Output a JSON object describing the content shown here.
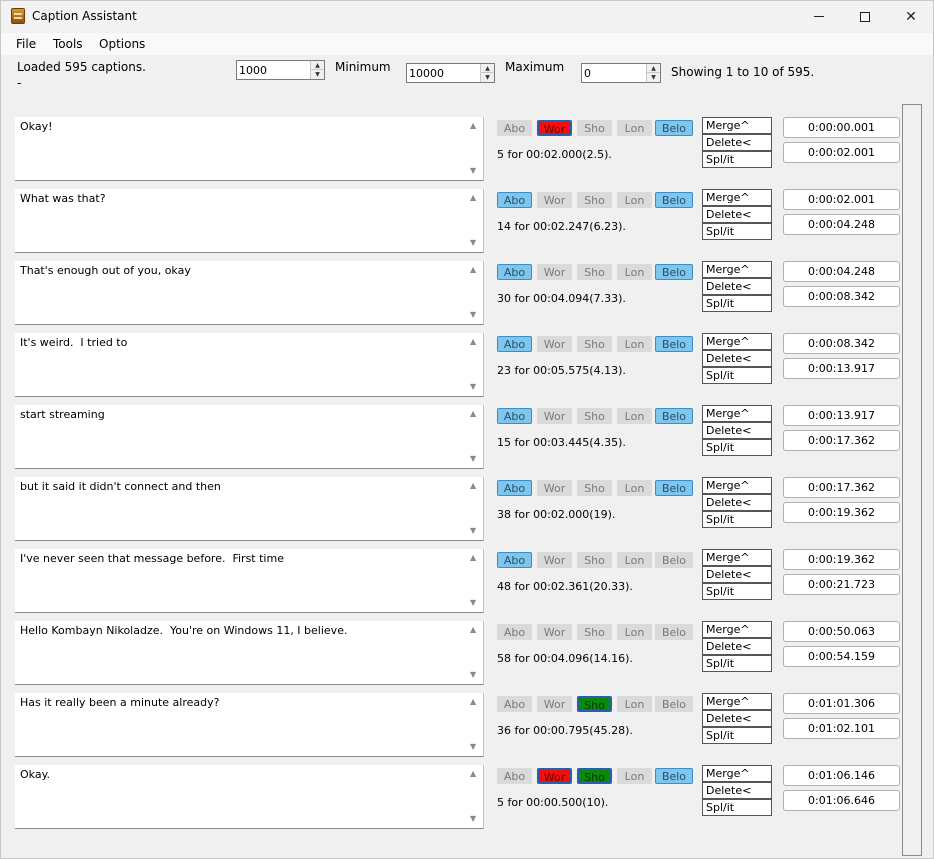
{
  "window": {
    "title": "Caption Assistant"
  },
  "menu": [
    "File",
    "Tools",
    "Options"
  ],
  "status": {
    "loaded": "Loaded 595 captions.",
    "dash": "-",
    "showing": "Showing 1 to 10 of 595."
  },
  "controls": {
    "first_value": "1000",
    "minimum_label": "Minimum",
    "minimum_value": "10000",
    "maximum_label": "Maximum",
    "maximum_value": "0"
  },
  "flag_labels": [
    "Abo",
    "Wor",
    "Sho",
    "Lon",
    "Belo"
  ],
  "action_labels": {
    "merge": "Merge^",
    "delete": "Delete<",
    "split": "Spl/it"
  },
  "colors": {
    "blue": "#7fc6ec",
    "red": "#f01010",
    "green": "#0a8a0a",
    "off": "#dadada"
  },
  "rows": [
    {
      "text": "Okay!",
      "stats": "5 for 00:02.000(2.5).",
      "start": "0:00:00.001",
      "end": "0:00:02.001",
      "flags": [
        "off",
        "red",
        "off",
        "off",
        "blue"
      ]
    },
    {
      "text": "What was that?",
      "stats": "14 for 00:02.247(6.23).",
      "start": "0:00:02.001",
      "end": "0:00:04.248",
      "flags": [
        "blue",
        "off",
        "off",
        "off",
        "blue"
      ]
    },
    {
      "text": "That's enough out of you, okay",
      "stats": "30 for 00:04.094(7.33).",
      "start": "0:00:04.248",
      "end": "0:00:08.342",
      "flags": [
        "blue",
        "off",
        "off",
        "off",
        "blue"
      ]
    },
    {
      "text": "It's weird.  I tried to",
      "stats": "23 for 00:05.575(4.13).",
      "start": "0:00:08.342",
      "end": "0:00:13.917",
      "flags": [
        "blue",
        "off",
        "off",
        "off",
        "blue"
      ]
    },
    {
      "text": "start streaming",
      "stats": "15 for 00:03.445(4.35).",
      "start": "0:00:13.917",
      "end": "0:00:17.362",
      "flags": [
        "blue",
        "off",
        "off",
        "off",
        "blue"
      ]
    },
    {
      "text": "but it said it didn't connect and then",
      "stats": "38 for 00:02.000(19).",
      "start": "0:00:17.362",
      "end": "0:00:19.362",
      "flags": [
        "blue",
        "off",
        "off",
        "off",
        "blue"
      ]
    },
    {
      "text": "I've never seen that message before.  First time",
      "stats": "48 for 00:02.361(20.33).",
      "start": "0:00:19.362",
      "end": "0:00:21.723",
      "flags": [
        "blue",
        "off",
        "off",
        "off",
        "off"
      ]
    },
    {
      "text": "Hello Kombayn Nikoladze.  You're on Windows 11, I believe.",
      "stats": "58 for 00:04.096(14.16).",
      "start": "0:00:50.063",
      "end": "0:00:54.159",
      "flags": [
        "off",
        "off",
        "off",
        "off",
        "off"
      ]
    },
    {
      "text": "Has it really been a minute already?",
      "stats": "36 for 00:00.795(45.28).",
      "start": "0:01:01.306",
      "end": "0:01:02.101",
      "flags": [
        "off",
        "off",
        "green",
        "off",
        "off"
      ]
    },
    {
      "text": "Okay.",
      "stats": "5 for 00:00.500(10).",
      "start": "0:01:06.146",
      "end": "0:01:06.646",
      "flags": [
        "off",
        "red",
        "green",
        "off",
        "blue"
      ]
    }
  ]
}
